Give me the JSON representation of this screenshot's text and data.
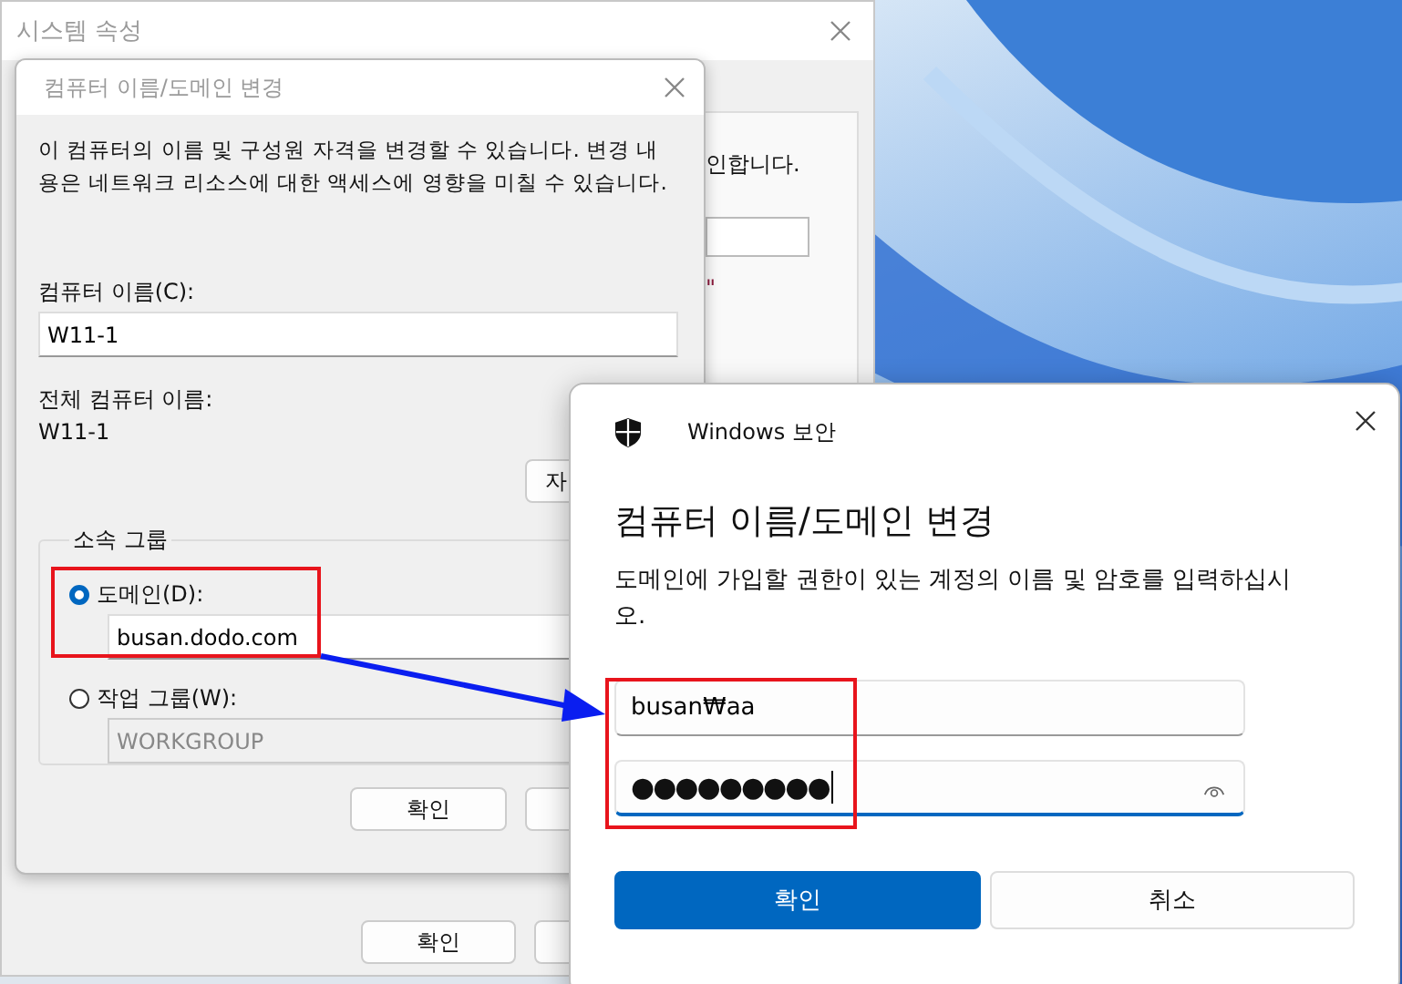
{
  "system_properties": {
    "title": "시스템 속성",
    "partial_text": "인합니다.",
    "partial_quote": "\"",
    "ok_button": "확인"
  },
  "change_dialog": {
    "title": "컴퓨터 이름/도메인 변경",
    "description": "이 컴퓨터의 이름 및 구성원 자격을 변경할 수 있습니다. 변경 내용은 네트워크 리소스에 대한 액세스에 영향을 미칠 수 있습니다.",
    "computer_name_label": "컴퓨터 이름(C):",
    "computer_name": "W11-1",
    "full_name_label": "전체 컴퓨터 이름:",
    "full_name": "W11-1",
    "more_button": "자",
    "member_group": {
      "title": "소속 그룹",
      "options": [
        {
          "label": "도메인(D):",
          "value": "busan.dodo.com",
          "selected": true,
          "disabled": false
        },
        {
          "label": "작업 그룹(W):",
          "value": "WORKGROUP",
          "selected": false,
          "disabled": true
        }
      ]
    },
    "ok_button": "확인"
  },
  "security_dialog": {
    "app": "Windows 보안",
    "heading": "컴퓨터 이름/도메인 변경",
    "description": "도메인에 가입할 권한이 있는 계정의 이름 및 암호를 입력하십시오.",
    "username": "busan₩aa",
    "password": "●●●●●●●●●",
    "ok_button": "확인",
    "cancel_button": "취소"
  }
}
